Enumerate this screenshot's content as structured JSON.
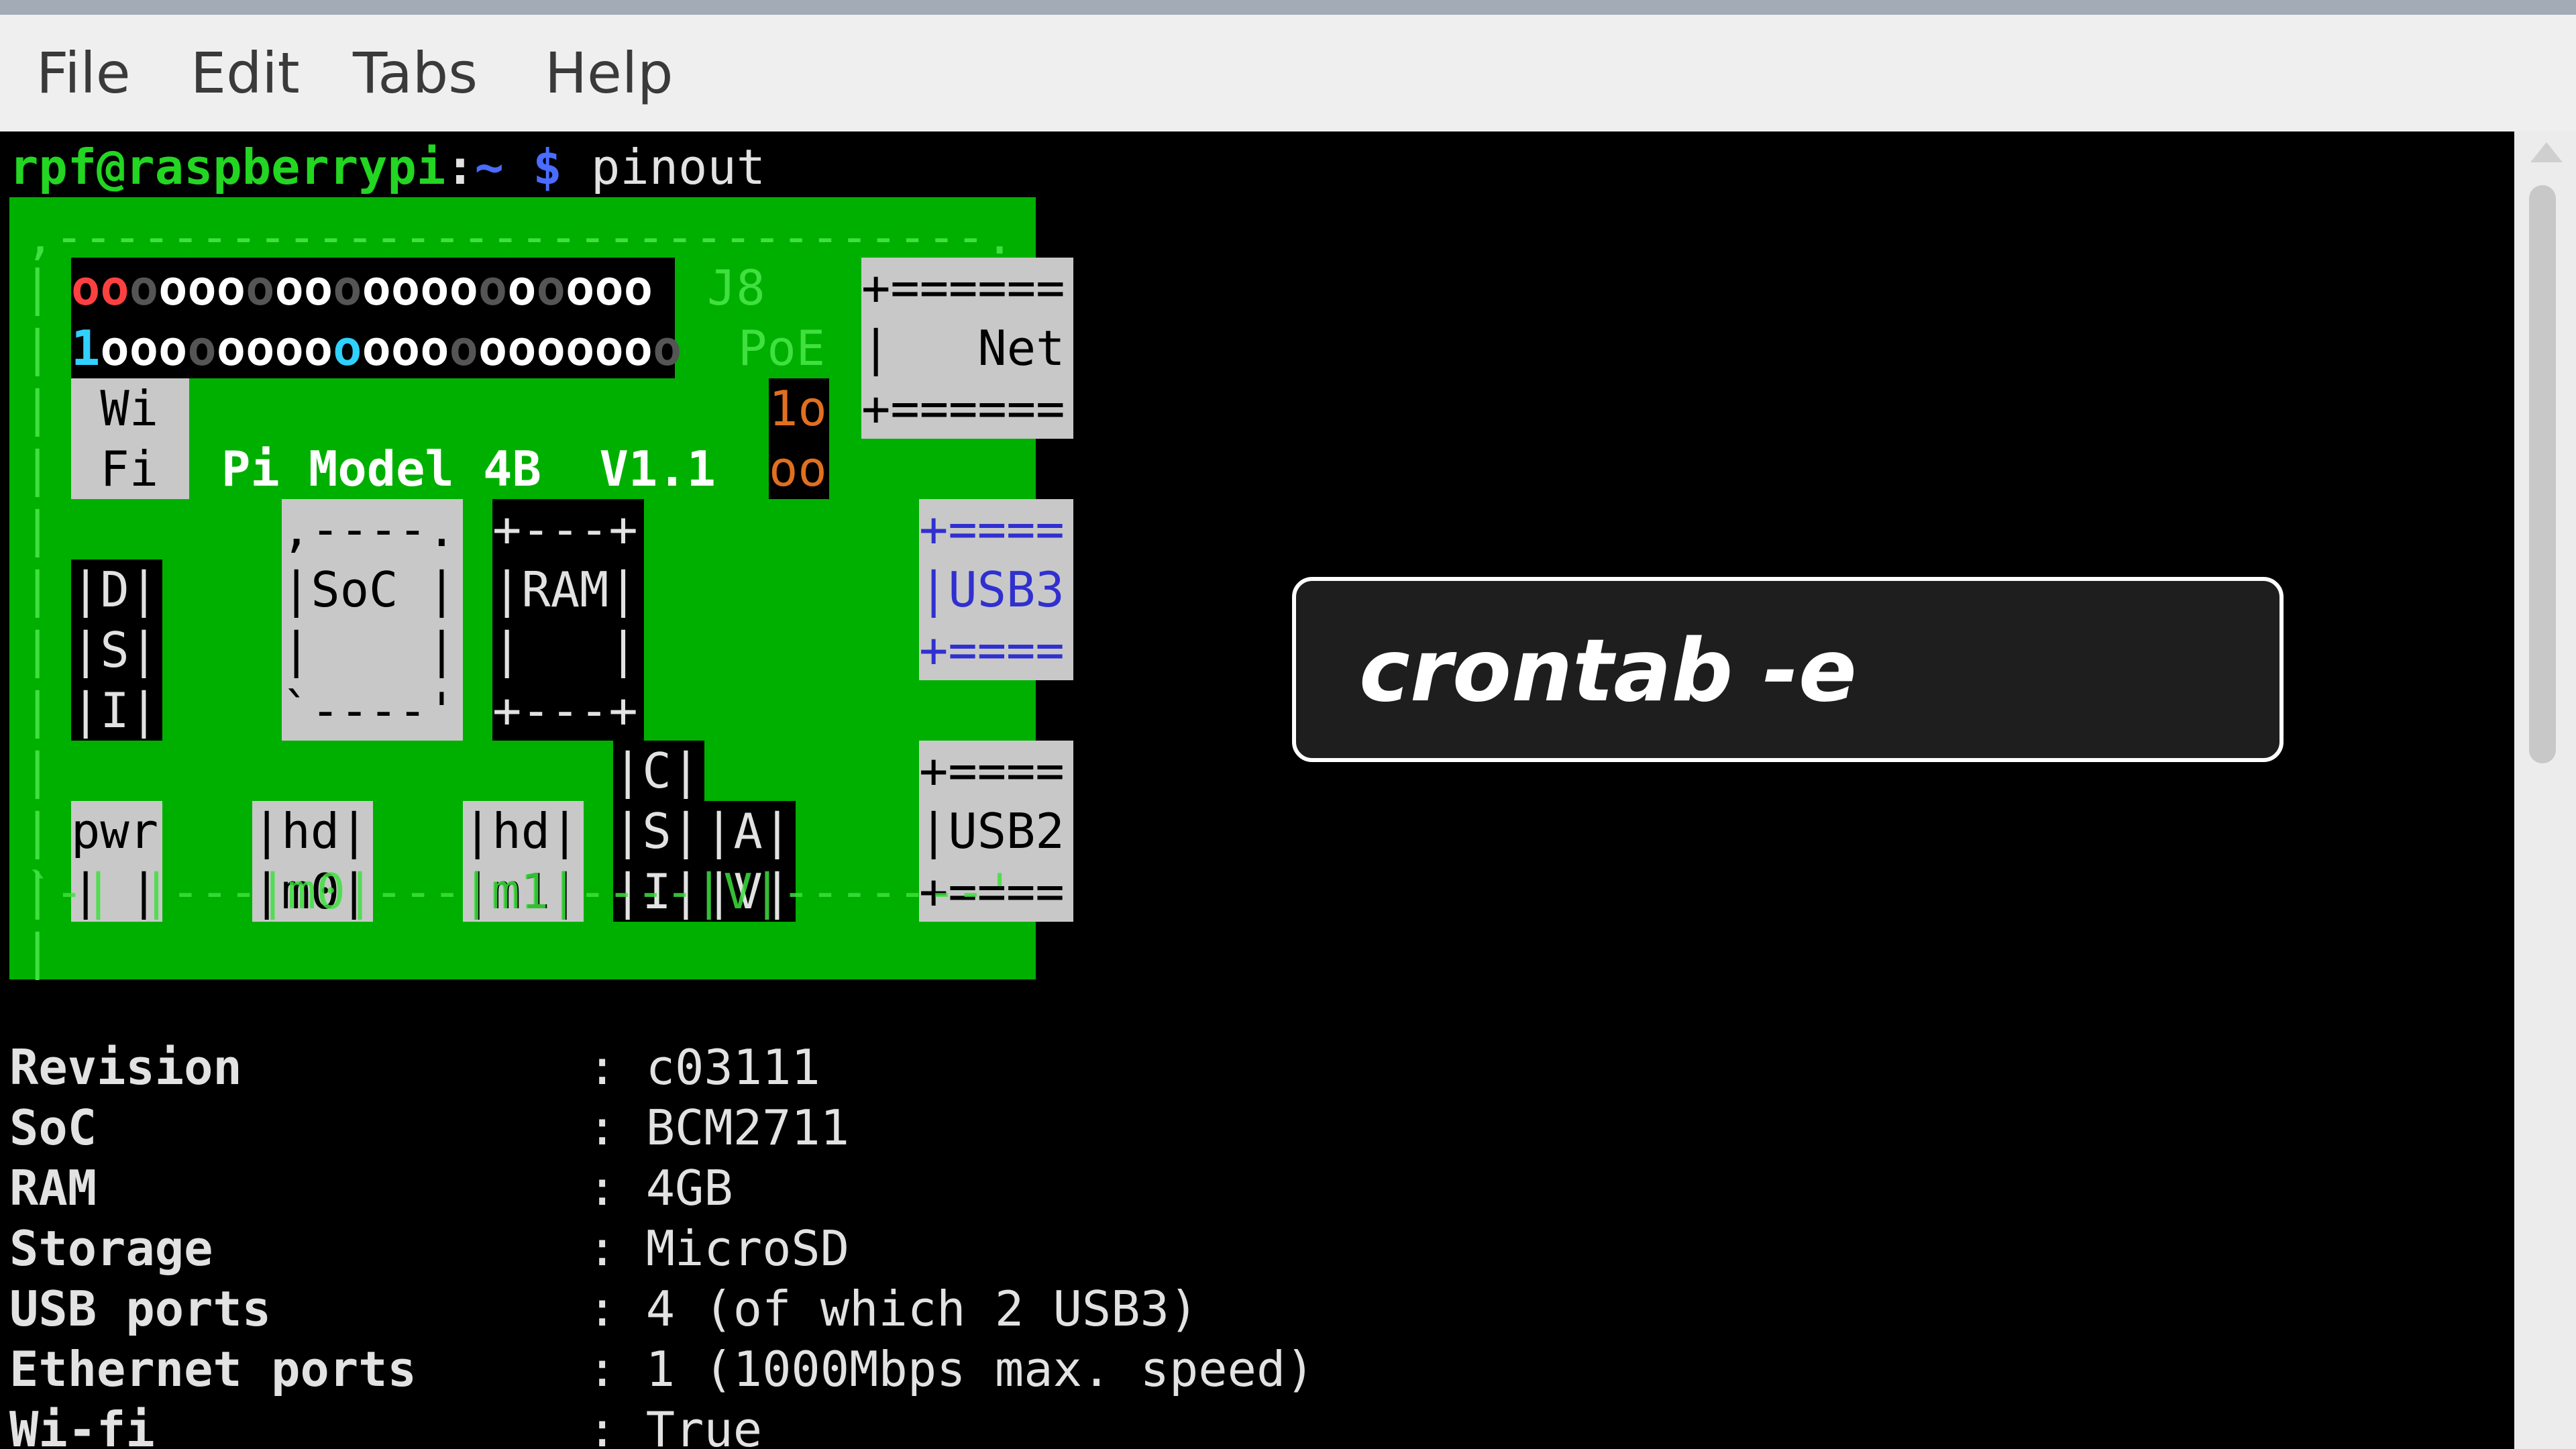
{
  "menu": {
    "file": "File",
    "edit": "Edit",
    "tabs": "Tabs",
    "help": "Help"
  },
  "prompt": {
    "user_host": "rpf@raspberrypi",
    "sep": ":",
    "path": "~",
    "symbol": "$",
    "command": "pinout"
  },
  "board": {
    "top_edge": ",--------------------------------.",
    "side_bars": "|\n|\n|\n|\n|\n|\n|\n|\n|\n|\n|\n|",
    "right_bars": "|\n\n\n\n\n\n|",
    "header_row1": "oooooooooooooooooooo",
    "header_row2": "1ooooooooooooooooooo",
    "j8": "J8",
    "poe": "PoE",
    "net": "+======\n|   Net\n+======",
    "wifi": " Wi\n Fi",
    "model": "Pi Model 4B  V1.1",
    "poe_header": "1o\noo",
    "usb3": "+====\n|USB3\n+====",
    "usb2": "+====\n|USB2\n+====",
    "dsi": "|D|\n|S|\n|I|",
    "soc": ",----.\n|SoC |\n|    |\n`----'",
    "ram": "+---+\n|RAM|\n|   |\n+---+",
    "csi": "|C|\n|S|\n|I|",
    "av": "|A|\n|V|",
    "pwr": "pwr\n| |",
    "hdmi0": "|hd|\n|m0|",
    "hdmi1": "|hd|\n|m1|",
    "bottom_edge": "`-| |---|m0|---|m1|----|V|-------'"
  },
  "specs": [
    {
      "key": "Revision",
      "value": ": c03111"
    },
    {
      "key": "SoC",
      "value": ": BCM2711"
    },
    {
      "key": "RAM",
      "value": ": 4GB"
    },
    {
      "key": "Storage",
      "value": ": MicroSD"
    },
    {
      "key": "USB ports",
      "value": ": 4 (of which 2 USB3)"
    },
    {
      "key": "Ethernet ports",
      "value": ": 1 (1000Mbps max. speed)"
    },
    {
      "key": "Wi-fi",
      "value": ": True"
    }
  ],
  "overlay": {
    "text": "crontab -e"
  },
  "colors": {
    "prompt_green": "#22d622",
    "prompt_blue": "#4a6cff",
    "board_green": "#00b000",
    "pin_red": "#ff4040",
    "pin_cyan": "#30d0ff",
    "poe_orange": "#e07020",
    "usb_blue": "#3030d0"
  }
}
